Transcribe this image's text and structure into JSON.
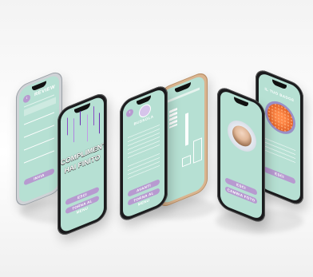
{
  "screens": {
    "review": {
      "title": "REVIEW",
      "button": "INVIA"
    },
    "complimenti": {
      "headline_1": "COMPLIMENTI!",
      "headline_2": "HAI FINITO",
      "button_1": "ESCI",
      "button_2": "TORNA AL MENU"
    },
    "bussola": {
      "title": "BUSSOLA",
      "button_1": "AVANTI",
      "button_2": "TORNA AL MENU"
    },
    "profile": {
      "button_1": "ESCI",
      "button_2": "CAMBIA FOTO"
    },
    "badge": {
      "title": "IL TUO BADGE",
      "button": "ESCI"
    }
  },
  "colors": {
    "screen_bg": "#b6e0d3",
    "accent_purple": "#b79ad0",
    "badge_orange": "#e86a2e"
  }
}
